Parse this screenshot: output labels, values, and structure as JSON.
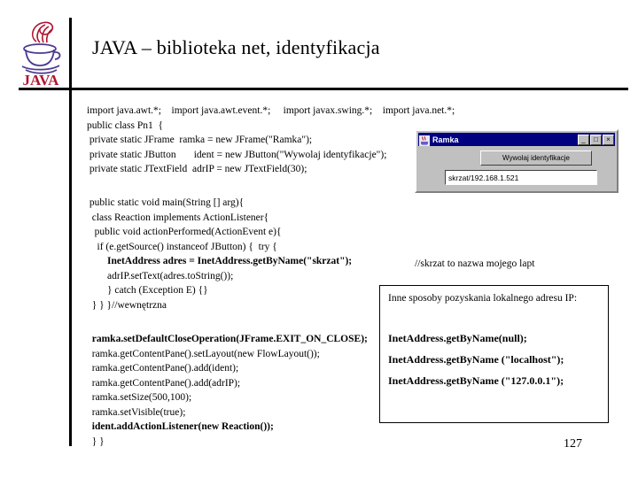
{
  "header": {
    "title": "JAVA –  biblioteka net, identyfikacja",
    "logo_label": "JAVA"
  },
  "code": {
    "imports_block": [
      "import java.awt.*;    import java.awt.event.*;     import javax.swing.*;    import java.net.*;",
      "public class Pn1  {",
      " private static JFrame  ramka = new JFrame(\"Ramka\");",
      " private static JButton       ident = new JButton(\"Wywolaj identyfikacje\");",
      " private static JTextField  adrIP = new JTextField(30);"
    ],
    "main_block": [
      " public static void main(String [] arg){",
      "  class Reaction implements ActionListener{",
      "   public void actionPerformed(ActionEvent e){",
      "    if (e.getSource() instanceof JButton) {  try {",
      "        InetAddress adres = InetAddress.getByName(\"skrzat\");",
      "        adrIP.setText(adres.toString());",
      "        } catch (Exception E) {}",
      "  } } }//wewnętrzna"
    ],
    "tail_block": [
      "  ramka.setDefaultCloseOperation(JFrame.EXIT_ON_CLOSE);",
      "  ramka.getContentPane().setLayout(new FlowLayout());",
      "  ramka.getContentPane().add(ident);",
      "  ramka.getContentPane().add(adrIP);",
      "  ramka.setSize(500,100);",
      "  ramka.setVisible(true);",
      "  ident.addActionListener(new Reaction());",
      "  } }"
    ],
    "comment_skrzat": "//skrzat to nazwa mojego lapt"
  },
  "info_box": {
    "title": "Inne sposoby pozyskania lokalnego adresu IP:",
    "items": [
      "InetAddress.getByName(null);",
      "InetAddress.getByName (\"localhost\");",
      "InetAddress.getByName (\"127.0.0.1\");"
    ]
  },
  "ramka_window": {
    "title": "Ramka",
    "button_label": "Wywolaj identyfikacje",
    "textfield_value": "skrzat/192.168.1.521",
    "minimize_label": "_",
    "maximize_label": "□",
    "close_label": "×"
  },
  "footer": {
    "page_number": "127"
  },
  "colors": {
    "titlebar": "#000080",
    "window_face": "#c0c0c0",
    "logo_red": "#b0152f",
    "logo_purple": "#4b3a8f",
    "rule": "#000000"
  }
}
